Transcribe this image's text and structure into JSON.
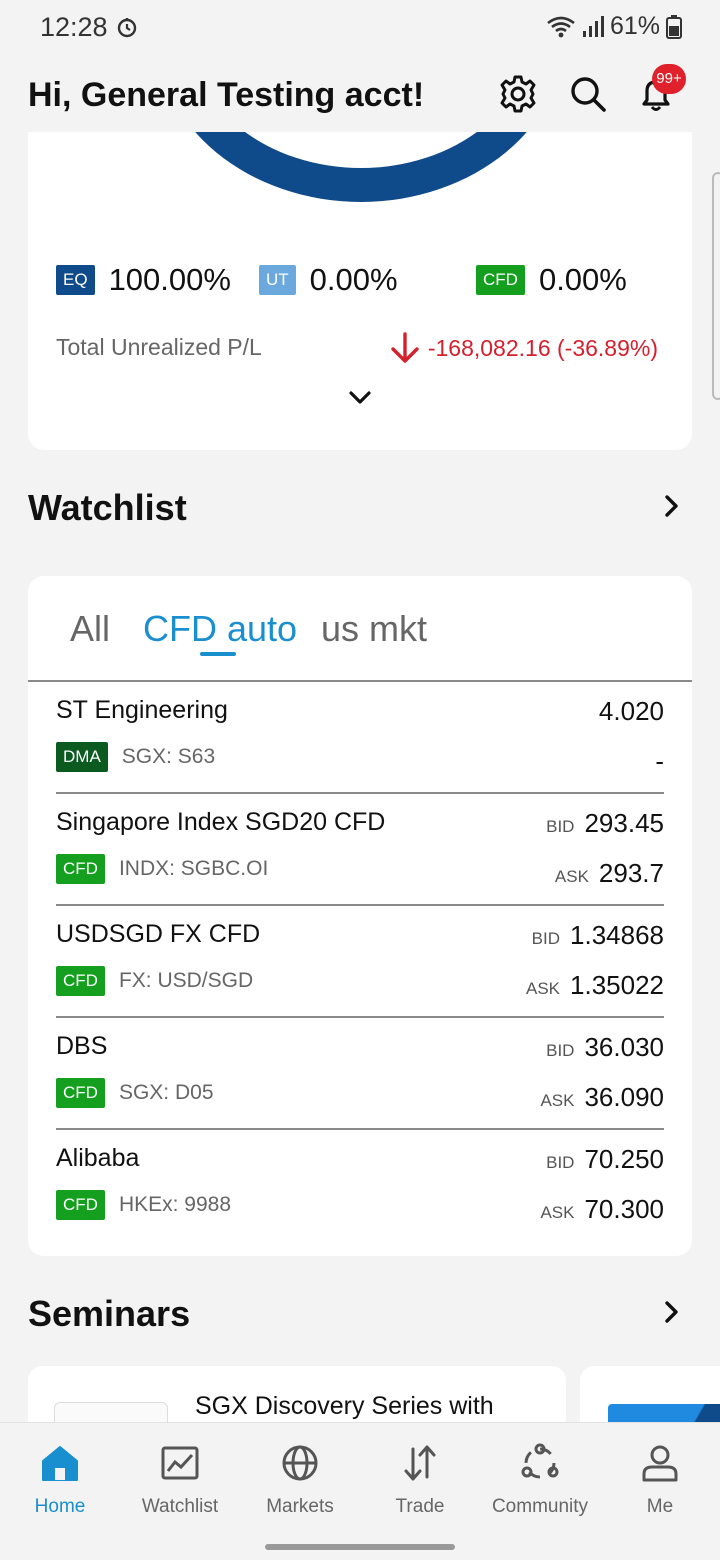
{
  "status_bar": {
    "time": "12:28",
    "battery": "61%"
  },
  "header": {
    "greeting": "Hi, General Testing acct!",
    "notification_badge": "99+"
  },
  "portfolio": {
    "allocations": [
      {
        "tag": "EQ",
        "value": "100.00%"
      },
      {
        "tag": "UT",
        "value": "0.00%"
      },
      {
        "tag": "CFD",
        "value": "0.00%"
      }
    ],
    "pl_label": "Total Unrealized P/L",
    "pl_value": "-168,082.16 (-36.89%)"
  },
  "watchlist": {
    "title": "Watchlist",
    "tabs": [
      "All",
      "CFD auto",
      "us mkt"
    ],
    "rows": [
      {
        "name": "ST Engineering",
        "tag": "DMA",
        "code": "SGX: S63",
        "top_label": "",
        "top_value": "4.020",
        "bottom_label": "",
        "bottom_value": "-"
      },
      {
        "name": "Singapore Index SGD20 CFD",
        "tag": "CFD",
        "code": "INDX: SGBC.OI",
        "top_label": "BID",
        "top_value": "293.45",
        "bottom_label": "ASK",
        "bottom_value": "293.7"
      },
      {
        "name": "USDSGD FX CFD",
        "tag": "CFD",
        "code": "FX: USD/SGD",
        "top_label": "BID",
        "top_value": "1.34868",
        "bottom_label": "ASK",
        "bottom_value": "1.35022"
      },
      {
        "name": "DBS",
        "tag": "CFD",
        "code": "SGX: D05",
        "top_label": "BID",
        "top_value": "36.030",
        "bottom_label": "ASK",
        "bottom_value": "36.090"
      },
      {
        "name": "Alibaba",
        "tag": "CFD",
        "code": "HKEx: 9988",
        "top_label": "BID",
        "top_value": "70.250",
        "bottom_label": "ASK",
        "bottom_value": "70.300"
      }
    ]
  },
  "seminars": {
    "title": "Seminars",
    "card_title": "SGX Discovery Series with"
  },
  "nav": [
    "Home",
    "Watchlist",
    "Markets",
    "Trade",
    "Community",
    "Me"
  ],
  "colors": {
    "accent": "#1a8fd0",
    "brand": "#0f4a8a",
    "negative": "#d61f2c",
    "cfd_tag": "#14a01e",
    "dma_tag": "#0b5a20"
  }
}
